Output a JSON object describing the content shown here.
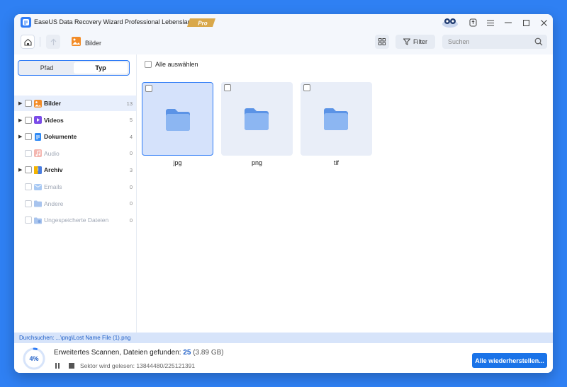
{
  "window": {
    "title": "EaseUS Data Recovery Wizard Professional Lebenslang",
    "badge": "Pro"
  },
  "toolbar": {
    "breadcrumb": "Bilder",
    "filter_label": "Filter",
    "search_placeholder": "Suchen"
  },
  "sidebar": {
    "tabs": [
      {
        "label": "Pfad",
        "active": false
      },
      {
        "label": "Typ",
        "active": true
      }
    ],
    "items": [
      {
        "label": "Bilder",
        "count": "13",
        "icon": "image-icon",
        "expandable": true,
        "selected": true,
        "enabled": true
      },
      {
        "label": "Videos",
        "count": "5",
        "icon": "video-icon",
        "expandable": true,
        "selected": false,
        "enabled": true
      },
      {
        "label": "Dokumente",
        "count": "4",
        "icon": "document-icon",
        "expandable": true,
        "selected": false,
        "enabled": true
      },
      {
        "label": "Audio",
        "count": "0",
        "icon": "audio-icon",
        "expandable": false,
        "selected": false,
        "enabled": false
      },
      {
        "label": "Archiv",
        "count": "3",
        "icon": "archive-icon",
        "expandable": true,
        "selected": false,
        "enabled": true
      },
      {
        "label": "Emails",
        "count": "0",
        "icon": "email-icon",
        "expandable": false,
        "selected": false,
        "enabled": false
      },
      {
        "label": "Andere",
        "count": "0",
        "icon": "other-folder-icon",
        "expandable": false,
        "selected": false,
        "enabled": false
      },
      {
        "label": "Ungespeicherte Dateien",
        "count": "0",
        "icon": "unsaved-files-icon",
        "expandable": false,
        "selected": false,
        "enabled": false
      }
    ]
  },
  "main": {
    "select_all_label": "Alle auswählen",
    "folders": [
      {
        "label": "jpg",
        "selected": true
      },
      {
        "label": "png",
        "selected": false
      },
      {
        "label": "tif",
        "selected": false
      }
    ]
  },
  "status": {
    "path": "Durchsuchen: ...\\png\\Lost Name File (1).png",
    "progress": "4%",
    "progress_fraction": 0.04,
    "scan_prefix": "Erweitertes Scannen, Dateien gefunden: ",
    "found_count": "25",
    "found_size": "(3.89 GB)",
    "sector_text": "Sektor wird gelesen: 13844480/225121391",
    "recover_all_label": "Alle wiederherstellen..."
  },
  "colors": {
    "accent": "#2f7cf6",
    "primary_button": "#1a73e8",
    "background": "#2f80f3"
  }
}
